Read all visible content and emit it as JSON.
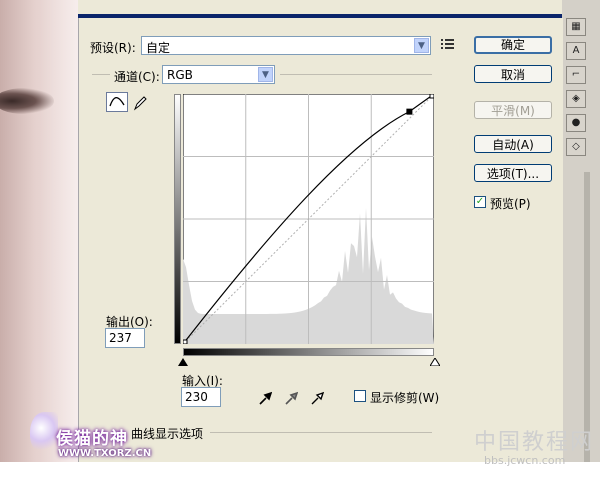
{
  "window": {
    "accent": "#0a246a",
    "background": "#ece9d8"
  },
  "preset": {
    "label": "预设(R):",
    "value": "自定",
    "menu_icon": "list-options-icon"
  },
  "channel": {
    "label": "通道(C):",
    "value": "RGB"
  },
  "buttons": {
    "ok": "确定",
    "cancel": "取消",
    "smooth": "平滑(M)",
    "auto": "自动(A)",
    "options": "选项(T)..."
  },
  "preview": {
    "label": "预览(P)",
    "checked": true,
    "check_glyph": "✓"
  },
  "output": {
    "label": "输出(O):",
    "value": "237"
  },
  "input": {
    "label": "输入(I):",
    "value": "230"
  },
  "show_clipping": {
    "label": "显示修剪(W)",
    "checked": false
  },
  "curve_display_options": {
    "label": "曲线显示选项"
  },
  "tools": {
    "curve_tool": "curve-point-icon",
    "pencil_tool": "pencil-icon"
  },
  "eyedroppers": [
    "black-point-eyedropper-icon",
    "gray-point-eyedropper-icon",
    "white-point-eyedropper-icon"
  ],
  "curve": {
    "control_point": {
      "input": 230,
      "output": 237
    },
    "range": [
      0,
      255
    ]
  },
  "right_panel_icons": [
    "history-icon",
    "text-icon",
    "layers-icon",
    "channels-icon",
    "paths-icon"
  ],
  "watermarks": {
    "left_main": "侯猫的神",
    "left_url": "WWW.TXORZ.CN",
    "right_main": "中国教程网",
    "right_url": "bbs.jcwcn.com"
  }
}
